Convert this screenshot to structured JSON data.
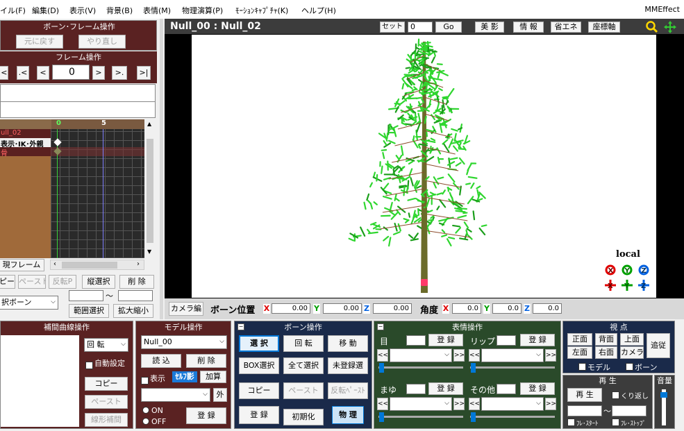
{
  "menu": {
    "items": [
      "イル(F)",
      "編集(D)",
      "表示(V)",
      "背景(B)",
      "表情(M)",
      "物理演算(P)",
      "ﾓｰｼｮﾝｷｬﾌﾟﾁｬ(K)",
      "ヘルプ(H)"
    ],
    "brand": "MMEffect"
  },
  "bone_frame_ops": {
    "title": "ボーン･フレーム操作",
    "undo": "元に戻す",
    "redo": "やり直し"
  },
  "frame_ops": {
    "title": "フレーム操作",
    "first": "|<",
    "prev_key": ".<",
    "prev": "<",
    "frame_value": "0",
    "next": ">",
    "next_key": ">.",
    "last": ">|"
  },
  "timeline": {
    "ruler_ticks": [
      "0",
      "5"
    ],
    "rows": [
      "ull_02",
      "表示･IK･外親",
      "骨"
    ],
    "current_frame_label": "現フレーム"
  },
  "bone_edit_buttons": {
    "copy": "ピー",
    "paste": "ペースト",
    "reverse_paste": "反転P",
    "vertical_select": "縦選択",
    "delete": "削 除",
    "bone_select": "択ボーン",
    "range_select": "範囲選択",
    "scale": "拡大縮小",
    "range_sep": "～"
  },
  "viewport": {
    "title": "Null_00 : Null_02",
    "set_label": "セット",
    "frame_value": "0",
    "go_label": "Go",
    "beauty": "美 影",
    "info": "情 報",
    "eco": "省エネ",
    "axis": "座標軸",
    "local_label": "local",
    "gizmo_rot": [
      "X",
      "Y",
      "Z"
    ],
    "gizmo_move": [
      "X",
      "Y",
      "Z"
    ],
    "colors": {
      "leaf": "#2fd62f",
      "leaf_dark": "#1b9e1b",
      "trunk": "#6b6b2a",
      "branch": "#8b4a2a",
      "x": "#e00000",
      "y": "#00a000",
      "z": "#0060e0",
      "local": "#2020a0"
    }
  },
  "bone_bar": {
    "camera_edit": "カメラ編",
    "bone_pos": "ボーン位置",
    "x": "0.00",
    "y": "0.00",
    "z": "0.00",
    "angle": "角度",
    "ax": "0.0",
    "ay": "0.0",
    "az": "0.0"
  },
  "interp": {
    "title": "補間曲線操作",
    "rotation": "回 転",
    "auto_set": "自動設定",
    "copy": "コピー",
    "paste": "ペースト",
    "linear": "線形補間"
  },
  "model_ops": {
    "title": "モデル操作",
    "model": "Null_00",
    "load": "読 込",
    "delete": "削 除",
    "display": "表示",
    "self_shadow": "ｾﾙﾌ影",
    "add": "加算",
    "outer": "外",
    "on": "ON",
    "off": "OFF",
    "register": "登 録"
  },
  "bone_ops": {
    "title": "ボーン操作",
    "select": "選 択",
    "rotate": "回 転",
    "move": "移 動",
    "box_select": "BOX選択",
    "select_all": "全て選択",
    "unregistered": "未登録選",
    "copy": "コピー",
    "paste": "ペースト",
    "reverse_paste": "反転ﾍﾟｰｽﾄ",
    "register": "登 録",
    "initialize": "初期化",
    "physics": "物 理"
  },
  "facial_ops": {
    "title": "表情操作",
    "eye": "目",
    "lip": "リップ",
    "brow": "まゆ",
    "other": "その他",
    "register": "登 録"
  },
  "view_ops": {
    "title": "視 点",
    "front": "正面",
    "back": "背面",
    "top": "上面",
    "follow": "追従",
    "left": "左面",
    "right": "右面",
    "camera": "カメラ",
    "model": "モデル",
    "bone": "ボーン"
  },
  "playback": {
    "title": "再 生",
    "play": "再 生",
    "repeat": "くり返し",
    "range_sep": "～",
    "frame_start": "ﾌﾚ･ｽﾀｰﾄ",
    "frame_stop": "ﾌﾚ･ｽﾄｯﾌﾟ"
  },
  "volume": {
    "title": "音量",
    "level": 0.9
  }
}
